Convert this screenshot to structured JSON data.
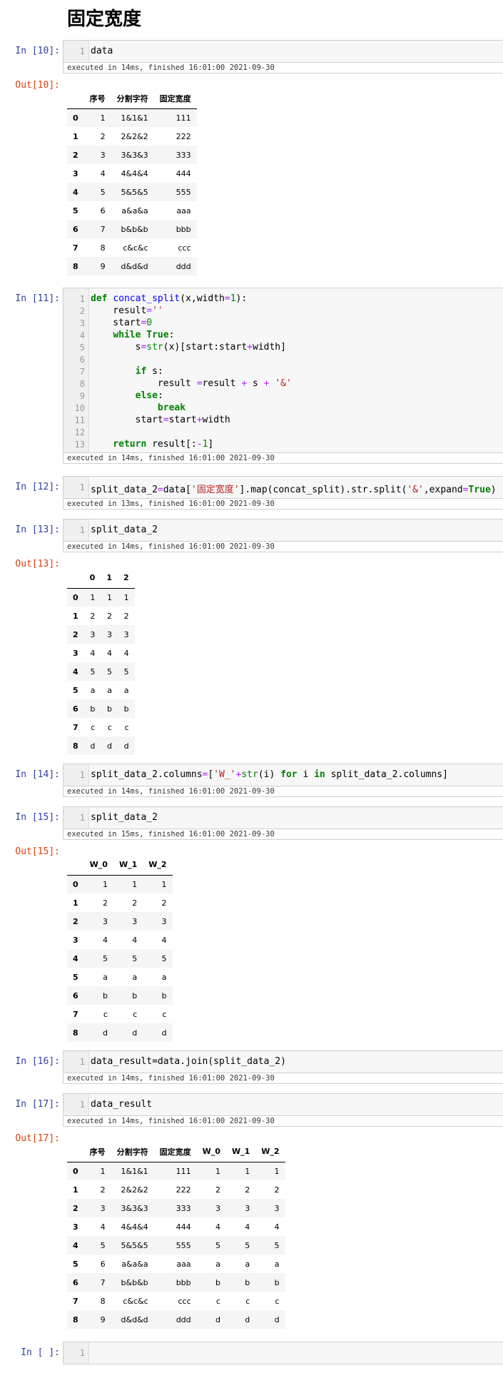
{
  "title": "固定宽度",
  "cells": {
    "c10": {
      "in": "In [10]:",
      "out": "Out[10]:",
      "exec": "executed in 14ms, finished 16:01:00 2021-09-30"
    },
    "c11": {
      "in": "In [11]:",
      "exec": "executed in 14ms, finished 16:01:00 2021-09-30"
    },
    "c12": {
      "in": "In [12]:",
      "exec": "executed in 13ms, finished 16:01:00 2021-09-30"
    },
    "c13": {
      "in": "In [13]:",
      "out": "Out[13]:",
      "exec": "executed in 14ms, finished 16:01:00 2021-09-30"
    },
    "c14": {
      "in": "In [14]:",
      "exec": "executed in 14ms, finished 16:01:00 2021-09-30"
    },
    "c15": {
      "in": "In [15]:",
      "out": "Out[15]:",
      "exec": "executed in 15ms, finished 16:01:00 2021-09-30"
    },
    "c16": {
      "in": "In [16]:",
      "exec": "executed in 14ms, finished 16:01:00 2021-09-30"
    },
    "c17": {
      "in": "In [17]:",
      "out": "Out[17]:",
      "exec": "executed in 14ms, finished 16:01:00 2021-09-30"
    },
    "cEmpty": {
      "in": "In [ ]:"
    }
  },
  "line_numbers": [
    "1",
    "2",
    "3",
    "4",
    "5",
    "6",
    "7",
    "8",
    "9",
    "10",
    "11",
    "12",
    "13"
  ],
  "code": {
    "c10": [
      "data"
    ],
    "c12": [
      "split_data_2=data['固定宽度'].map(concat_split).str.split('&',expand=True)"
    ],
    "c13": [
      "split_data_2"
    ],
    "c14": [
      "split_data_2.columns=['W_'+str(i) for i in split_data_2.columns]"
    ],
    "c15": [
      "split_data_2"
    ],
    "c16": [
      "data_result=data.join(split_data_2)"
    ],
    "c17": [
      "data_result"
    ]
  },
  "tables": {
    "t10": {
      "columns": [
        "序号",
        "分割字符",
        "固定宽度"
      ],
      "index": [
        "0",
        "1",
        "2",
        "3",
        "4",
        "5",
        "6",
        "7",
        "8"
      ],
      "rows": [
        [
          "1",
          "1&1&1",
          "111"
        ],
        [
          "2",
          "2&2&2",
          "222"
        ],
        [
          "3",
          "3&3&3",
          "333"
        ],
        [
          "4",
          "4&4&4",
          "444"
        ],
        [
          "5",
          "5&5&5",
          "555"
        ],
        [
          "6",
          "a&a&a",
          "aaa"
        ],
        [
          "7",
          "b&b&b",
          "bbb"
        ],
        [
          "8",
          "c&c&c",
          "ccc"
        ],
        [
          "9",
          "d&d&d",
          "ddd"
        ]
      ]
    },
    "t13": {
      "columns": [
        "0",
        "1",
        "2"
      ],
      "index": [
        "0",
        "1",
        "2",
        "3",
        "4",
        "5",
        "6",
        "7",
        "8"
      ],
      "rows": [
        [
          "1",
          "1",
          "1"
        ],
        [
          "2",
          "2",
          "2"
        ],
        [
          "3",
          "3",
          "3"
        ],
        [
          "4",
          "4",
          "4"
        ],
        [
          "5",
          "5",
          "5"
        ],
        [
          "a",
          "a",
          "a"
        ],
        [
          "b",
          "b",
          "b"
        ],
        [
          "c",
          "c",
          "c"
        ],
        [
          "d",
          "d",
          "d"
        ]
      ]
    },
    "t15": {
      "columns": [
        "W_0",
        "W_1",
        "W_2"
      ],
      "index": [
        "0",
        "1",
        "2",
        "3",
        "4",
        "5",
        "6",
        "7",
        "8"
      ],
      "rows": [
        [
          "1",
          "1",
          "1"
        ],
        [
          "2",
          "2",
          "2"
        ],
        [
          "3",
          "3",
          "3"
        ],
        [
          "4",
          "4",
          "4"
        ],
        [
          "5",
          "5",
          "5"
        ],
        [
          "a",
          "a",
          "a"
        ],
        [
          "b",
          "b",
          "b"
        ],
        [
          "c",
          "c",
          "c"
        ],
        [
          "d",
          "d",
          "d"
        ]
      ]
    },
    "t17": {
      "columns": [
        "序号",
        "分割字符",
        "固定宽度",
        "W_0",
        "W_1",
        "W_2"
      ],
      "index": [
        "0",
        "1",
        "2",
        "3",
        "4",
        "5",
        "6",
        "7",
        "8"
      ],
      "rows": [
        [
          "1",
          "1&1&1",
          "111",
          "1",
          "1",
          "1"
        ],
        [
          "2",
          "2&2&2",
          "222",
          "2",
          "2",
          "2"
        ],
        [
          "3",
          "3&3&3",
          "333",
          "3",
          "3",
          "3"
        ],
        [
          "4",
          "4&4&4",
          "444",
          "4",
          "4",
          "4"
        ],
        [
          "5",
          "5&5&5",
          "555",
          "5",
          "5",
          "5"
        ],
        [
          "6",
          "a&a&a",
          "aaa",
          "a",
          "a",
          "a"
        ],
        [
          "7",
          "b&b&b",
          "bbb",
          "b",
          "b",
          "b"
        ],
        [
          "8",
          "c&c&c",
          "ccc",
          "c",
          "c",
          "c"
        ],
        [
          "9",
          "d&d&d",
          "ddd",
          "d",
          "d",
          "d"
        ]
      ]
    }
  }
}
